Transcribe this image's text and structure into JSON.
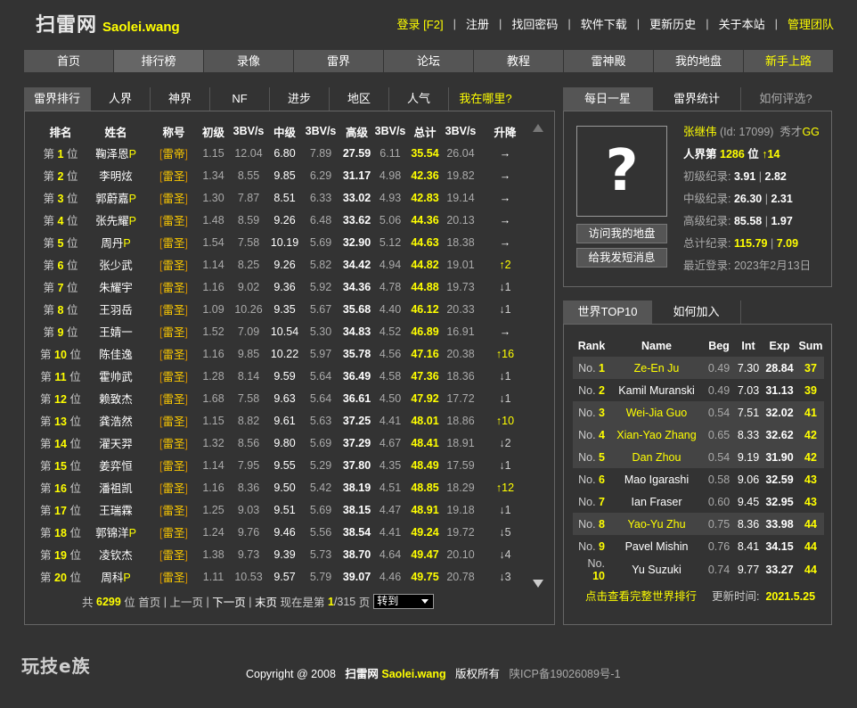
{
  "header": {
    "logo_cn": "扫雷网",
    "logo_en": "Saolei.wang",
    "nav": [
      {
        "label": "登录 [F2]",
        "highlight": true
      },
      {
        "label": "注册",
        "highlight": false
      },
      {
        "label": "找回密码",
        "highlight": false
      },
      {
        "label": "软件下载",
        "highlight": false
      },
      {
        "label": "更新历史",
        "highlight": false
      },
      {
        "label": "关于本站",
        "highlight": false
      },
      {
        "label": "管理团队",
        "highlight": true
      }
    ]
  },
  "main_nav": [
    "首页",
    "排行榜",
    "录像",
    "雷界",
    "论坛",
    "教程",
    "雷神殿",
    "我的地盘",
    "新手上路"
  ],
  "left_tabs": [
    "雷界排行",
    "人界",
    "神界",
    "NF",
    "进步",
    "地区",
    "人气",
    "我在哪里?"
  ],
  "ranking": {
    "headers": [
      "排名",
      "姓名",
      "称号",
      "初级",
      "3BV/s",
      "中级",
      "3BV/s",
      "高级",
      "3BV/s",
      "总计",
      "3BV/s",
      "升降"
    ],
    "rows": [
      {
        "pos_pre": "第",
        "pos": "1",
        "pos_suf": "位",
        "name": "鞠泽恩",
        "p": "P",
        "title": "雷帝",
        "beg": "1.15",
        "beg_bv": "12.04",
        "int": "6.80",
        "int_bv": "7.89",
        "exp": "27.59",
        "exp_bv": "6.11",
        "total": "35.54",
        "total_bv": "26.04",
        "change": "→",
        "dir": "same"
      },
      {
        "pos_pre": "第",
        "pos": "2",
        "pos_suf": "位",
        "name": "李明炫",
        "p": "",
        "title": "雷圣",
        "beg": "1.34",
        "beg_bv": "8.55",
        "int": "9.85",
        "int_bv": "6.29",
        "exp": "31.17",
        "exp_bv": "4.98",
        "total": "42.36",
        "total_bv": "19.82",
        "change": "→",
        "dir": "same"
      },
      {
        "pos_pre": "第",
        "pos": "3",
        "pos_suf": "位",
        "name": "郭蔚嘉",
        "p": "P",
        "title": "雷圣",
        "beg": "1.30",
        "beg_bv": "7.87",
        "int": "8.51",
        "int_bv": "6.33",
        "exp": "33.02",
        "exp_bv": "4.93",
        "total": "42.83",
        "total_bv": "19.14",
        "change": "→",
        "dir": "same"
      },
      {
        "pos_pre": "第",
        "pos": "4",
        "pos_suf": "位",
        "name": "张先耀",
        "p": "P",
        "title": "雷圣",
        "beg": "1.48",
        "beg_bv": "8.59",
        "int": "9.26",
        "int_bv": "6.48",
        "exp": "33.62",
        "exp_bv": "5.06",
        "total": "44.36",
        "total_bv": "20.13",
        "change": "→",
        "dir": "same"
      },
      {
        "pos_pre": "第",
        "pos": "5",
        "pos_suf": "位",
        "name": "周丹",
        "p": "P",
        "title": "雷圣",
        "beg": "1.54",
        "beg_bv": "7.58",
        "int": "10.19",
        "int_bv": "5.69",
        "exp": "32.90",
        "exp_bv": "5.12",
        "total": "44.63",
        "total_bv": "18.38",
        "change": "→",
        "dir": "same"
      },
      {
        "pos_pre": "第",
        "pos": "6",
        "pos_suf": "位",
        "name": "张少武",
        "p": "",
        "title": "雷圣",
        "beg": "1.14",
        "beg_bv": "8.25",
        "int": "9.26",
        "int_bv": "5.82",
        "exp": "34.42",
        "exp_bv": "4.94",
        "total": "44.82",
        "total_bv": "19.01",
        "change": "↑2",
        "dir": "up"
      },
      {
        "pos_pre": "第",
        "pos": "7",
        "pos_suf": "位",
        "name": "朱耀宇",
        "p": "",
        "title": "雷圣",
        "beg": "1.16",
        "beg_bv": "9.02",
        "int": "9.36",
        "int_bv": "5.92",
        "exp": "34.36",
        "exp_bv": "4.78",
        "total": "44.88",
        "total_bv": "19.73",
        "change": "↓1",
        "dir": "down"
      },
      {
        "pos_pre": "第",
        "pos": "8",
        "pos_suf": "位",
        "name": "王羽岳",
        "p": "",
        "title": "雷圣",
        "beg": "1.09",
        "beg_bv": "10.26",
        "int": "9.35",
        "int_bv": "5.67",
        "exp": "35.68",
        "exp_bv": "4.40",
        "total": "46.12",
        "total_bv": "20.33",
        "change": "↓1",
        "dir": "down"
      },
      {
        "pos_pre": "第",
        "pos": "9",
        "pos_suf": "位",
        "name": "王婧一",
        "p": "",
        "title": "雷圣",
        "beg": "1.52",
        "beg_bv": "7.09",
        "int": "10.54",
        "int_bv": "5.30",
        "exp": "34.83",
        "exp_bv": "4.52",
        "total": "46.89",
        "total_bv": "16.91",
        "change": "→",
        "dir": "same"
      },
      {
        "pos_pre": "第",
        "pos": "10",
        "pos_suf": "位",
        "name": "陈佳逸",
        "p": "",
        "title": "雷圣",
        "beg": "1.16",
        "beg_bv": "9.85",
        "int": "10.22",
        "int_bv": "5.97",
        "exp": "35.78",
        "exp_bv": "4.56",
        "total": "47.16",
        "total_bv": "20.38",
        "change": "↑16",
        "dir": "up"
      },
      {
        "pos_pre": "第",
        "pos": "11",
        "pos_suf": "位",
        "name": "霍帅武",
        "p": "",
        "title": "雷圣",
        "beg": "1.28",
        "beg_bv": "8.14",
        "int": "9.59",
        "int_bv": "5.64",
        "exp": "36.49",
        "exp_bv": "4.58",
        "total": "47.36",
        "total_bv": "18.36",
        "change": "↓1",
        "dir": "down"
      },
      {
        "pos_pre": "第",
        "pos": "12",
        "pos_suf": "位",
        "name": "赖致杰",
        "p": "",
        "title": "雷圣",
        "beg": "1.68",
        "beg_bv": "7.58",
        "int": "9.63",
        "int_bv": "5.64",
        "exp": "36.61",
        "exp_bv": "4.50",
        "total": "47.92",
        "total_bv": "17.72",
        "change": "↓1",
        "dir": "down"
      },
      {
        "pos_pre": "第",
        "pos": "13",
        "pos_suf": "位",
        "name": "龚浩然",
        "p": "",
        "title": "雷圣",
        "beg": "1.15",
        "beg_bv": "8.82",
        "int": "9.61",
        "int_bv": "5.63",
        "exp": "37.25",
        "exp_bv": "4.41",
        "total": "48.01",
        "total_bv": "18.86",
        "change": "↑10",
        "dir": "up"
      },
      {
        "pos_pre": "第",
        "pos": "14",
        "pos_suf": "位",
        "name": "濯天羿",
        "p": "",
        "title": "雷圣",
        "beg": "1.32",
        "beg_bv": "8.56",
        "int": "9.80",
        "int_bv": "5.69",
        "exp": "37.29",
        "exp_bv": "4.67",
        "total": "48.41",
        "total_bv": "18.91",
        "change": "↓2",
        "dir": "down"
      },
      {
        "pos_pre": "第",
        "pos": "15",
        "pos_suf": "位",
        "name": "姜弈恒",
        "p": "",
        "title": "雷圣",
        "beg": "1.14",
        "beg_bv": "7.95",
        "int": "9.55",
        "int_bv": "5.29",
        "exp": "37.80",
        "exp_bv": "4.35",
        "total": "48.49",
        "total_bv": "17.59",
        "change": "↓1",
        "dir": "down"
      },
      {
        "pos_pre": "第",
        "pos": "16",
        "pos_suf": "位",
        "name": "潘祖凯",
        "p": "",
        "title": "雷圣",
        "beg": "1.16",
        "beg_bv": "8.36",
        "int": "9.50",
        "int_bv": "5.42",
        "exp": "38.19",
        "exp_bv": "4.51",
        "total": "48.85",
        "total_bv": "18.29",
        "change": "↑12",
        "dir": "up"
      },
      {
        "pos_pre": "第",
        "pos": "17",
        "pos_suf": "位",
        "name": "王瑞霖",
        "p": "",
        "title": "雷圣",
        "beg": "1.25",
        "beg_bv": "9.03",
        "int": "9.51",
        "int_bv": "5.69",
        "exp": "38.15",
        "exp_bv": "4.47",
        "total": "48.91",
        "total_bv": "19.18",
        "change": "↓1",
        "dir": "down"
      },
      {
        "pos_pre": "第",
        "pos": "18",
        "pos_suf": "位",
        "name": "郭锦洋",
        "p": "P",
        "title": "雷圣",
        "beg": "1.24",
        "beg_bv": "9.76",
        "int": "9.46",
        "int_bv": "5.56",
        "exp": "38.54",
        "exp_bv": "4.41",
        "total": "49.24",
        "total_bv": "19.72",
        "change": "↓5",
        "dir": "down"
      },
      {
        "pos_pre": "第",
        "pos": "19",
        "pos_suf": "位",
        "name": "凌钦杰",
        "p": "",
        "title": "雷圣",
        "beg": "1.38",
        "beg_bv": "9.73",
        "int": "9.39",
        "int_bv": "5.73",
        "exp": "38.70",
        "exp_bv": "4.64",
        "total": "49.47",
        "total_bv": "20.10",
        "change": "↓4",
        "dir": "down"
      },
      {
        "pos_pre": "第",
        "pos": "20",
        "pos_suf": "位",
        "name": "周科",
        "p": "P",
        "title": "雷圣",
        "beg": "1.11",
        "beg_bv": "10.53",
        "int": "9.57",
        "int_bv": "5.79",
        "exp": "39.07",
        "exp_bv": "4.46",
        "total": "49.75",
        "total_bv": "20.78",
        "change": "↓3",
        "dir": "down"
      }
    ]
  },
  "pager": {
    "prefix": "共",
    "total": "6299",
    "unit": "位",
    "first": "首页",
    "prev": "上一页",
    "next": "下一页",
    "last": "末页",
    "current_prefix": "现在是第",
    "current": "1",
    "of": "/315",
    "page_unit": "页",
    "goto": "转到"
  },
  "star_tabs": [
    "每日一星",
    "雷界统计",
    "如何评选?"
  ],
  "star": {
    "avatar_glyph": "?",
    "name": "张继伟",
    "id_text": "(Id: 17099)",
    "rank_title": "秀才",
    "rank_suffix": "GG",
    "human_rank_prefix": "人界第",
    "human_rank": "1286",
    "human_rank_unit": "位",
    "human_rank_change": "↑14",
    "records": [
      {
        "label": "初级纪录:",
        "time": "3.91",
        "bv": "2.82"
      },
      {
        "label": "中级纪录:",
        "time": "26.30",
        "bv": "2.31"
      },
      {
        "label": "高级纪录:",
        "time": "85.58",
        "bv": "1.97"
      },
      {
        "label": "总计纪录:",
        "time": "115.79",
        "bv": "7.09"
      }
    ],
    "last_login_label": "最近登录:",
    "last_login": "2023年2月13日",
    "visit_button": "访问我的地盘",
    "message_button": "给我发短消息"
  },
  "top_tabs": [
    "世界TOP10",
    "如何加入"
  ],
  "top10": {
    "headers": [
      "Rank",
      "Name",
      "Beg",
      "Int",
      "Exp",
      "Sum"
    ],
    "rows": [
      {
        "no": "1",
        "name": "Ze-En Ju",
        "beg": "0.49",
        "int": "7.30",
        "exp": "28.84",
        "sum": "37",
        "hl": true
      },
      {
        "no": "2",
        "name": "Kamil Muranski",
        "beg": "0.49",
        "int": "7.03",
        "exp": "31.13",
        "sum": "39",
        "hl": false
      },
      {
        "no": "3",
        "name": "Wei-Jia Guo",
        "beg": "0.54",
        "int": "7.51",
        "exp": "32.02",
        "sum": "41",
        "hl": true
      },
      {
        "no": "4",
        "name": "Xian-Yao Zhang",
        "beg": "0.65",
        "int": "8.33",
        "exp": "32.62",
        "sum": "42",
        "hl": true
      },
      {
        "no": "5",
        "name": "Dan Zhou",
        "beg": "0.54",
        "int": "9.19",
        "exp": "31.90",
        "sum": "42",
        "hl": true
      },
      {
        "no": "6",
        "name": "Mao Igarashi",
        "beg": "0.58",
        "int": "9.06",
        "exp": "32.59",
        "sum": "43",
        "hl": false
      },
      {
        "no": "7",
        "name": "Ian Fraser",
        "beg": "0.60",
        "int": "9.45",
        "exp": "32.95",
        "sum": "43",
        "hl": false
      },
      {
        "no": "8",
        "name": "Yao-Yu Zhu",
        "beg": "0.75",
        "int": "8.36",
        "exp": "33.98",
        "sum": "44",
        "hl": true
      },
      {
        "no": "9",
        "name": "Pavel Mishin",
        "beg": "0.76",
        "int": "8.41",
        "exp": "34.15",
        "sum": "44",
        "hl": false
      },
      {
        "no": "10",
        "name": "Yu Suzuki",
        "beg": "0.74",
        "int": "9.77",
        "exp": "33.27",
        "sum": "44",
        "hl": false
      }
    ],
    "more_link": "点击查看完整世界排行",
    "updated_label": "更新时间:",
    "updated": "2021.5.25"
  },
  "footer": {
    "logo": "玩技e族",
    "copyright": "Copyright @ 2008",
    "site_cn": "扫雷网",
    "site_en": "Saolei.wang",
    "rights": "版权所有",
    "icp": "陕ICP备19026089号-1"
  }
}
